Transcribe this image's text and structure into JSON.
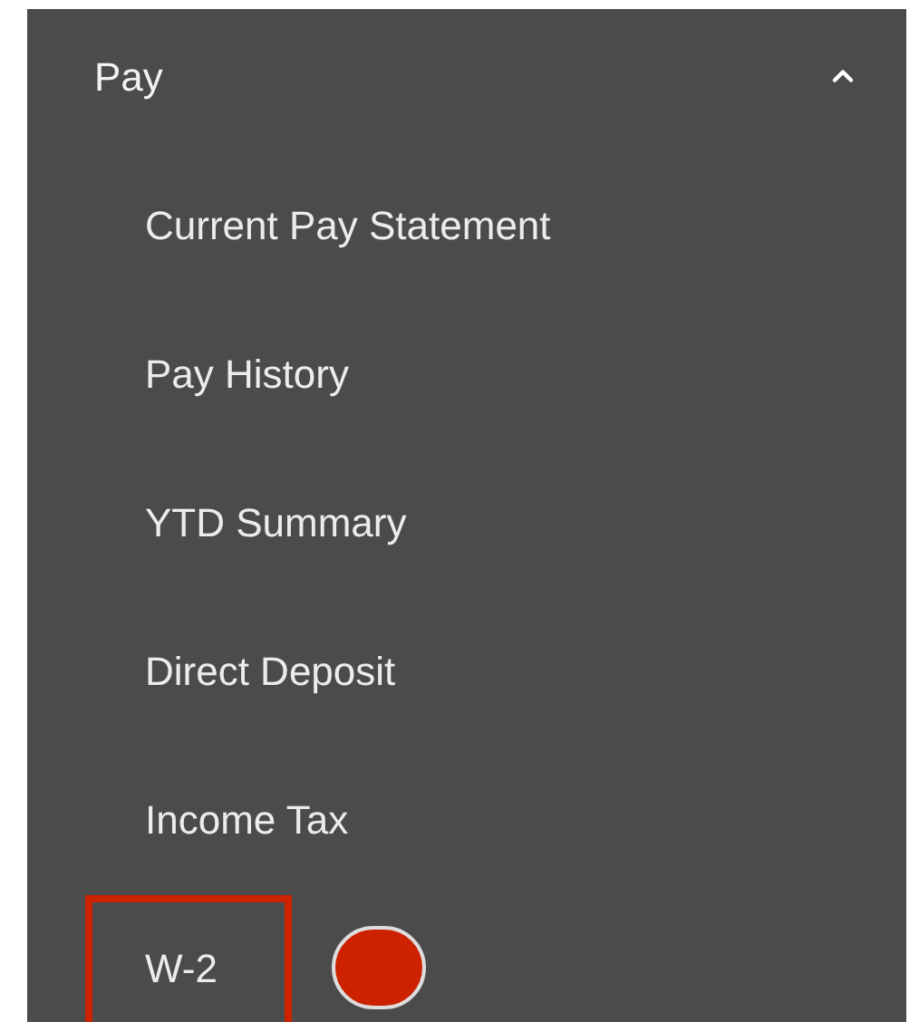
{
  "menu": {
    "title": "Pay",
    "expanded": true,
    "items": [
      {
        "label": "Current Pay Statement",
        "highlighted": false,
        "marked": false
      },
      {
        "label": "Pay History",
        "highlighted": false,
        "marked": false
      },
      {
        "label": "YTD Summary",
        "highlighted": false,
        "marked": false
      },
      {
        "label": "Direct Deposit",
        "highlighted": false,
        "marked": false
      },
      {
        "label": "Income Tax",
        "highlighted": false,
        "marked": false
      },
      {
        "label": "W-2",
        "highlighted": true,
        "marked": true
      }
    ]
  }
}
